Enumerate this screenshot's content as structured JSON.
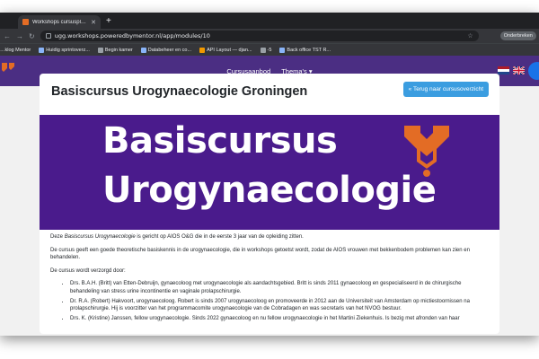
{
  "browser": {
    "tab_title": "Workshops cursusplatform | po",
    "new_tab": "+",
    "url": "ugg.workshops.poweredbymentor.nl/app/modules/10",
    "profile_label": "Onderbreken",
    "bookmarks": [
      "…klog Mentor",
      "Huidig sprintoverz...",
      "Begin kamer",
      "Databeheer en co...",
      "API Layout — djan...",
      "-5",
      "Back office TST R..."
    ]
  },
  "site": {
    "nav": {
      "courses": "Cursusaanbod",
      "themes": "Thema's"
    },
    "colors": {
      "nav_bg": "#4b2e83",
      "banner_bg": "#4a1b8c",
      "accent": "#e36c25",
      "button": "#3b9de0"
    }
  },
  "page": {
    "title": "Basiscursus Urogynaecologie Groningen",
    "back_button": "« Terug naar cursusoverzicht",
    "banner": {
      "line1": "Basiscursus",
      "line2": "Urogynaecologie"
    },
    "intro_pre": "Deze ",
    "intro_em": "Basiscursus Urogynaecologie",
    "intro_post": " is gericht op AIOS O&G die in de eerste 3 jaar van de opleiding zitten.",
    "para2": "De cursus geeft een goede theoretische basiskennis in de urogynaecologie, die in workshops getoetst wordt, zodat de AIOS vrouwen met bekkenbodem problemen kan zien en behandelen.",
    "para3": "De cursus wordt verzorgd door:",
    "speakers": [
      "Drs. B.A.H. (Britt) van Etten-Debruijn, gynaecoloog met urogynaecologie als aandachtsgebied. Britt is sinds 2011 gynaecoloog en gespecialiseerd in de chirurgische behandeling van stress urine incontinentie en vaginale prolapschirurgie.",
      "Dr. R.A. (Robert) Hakvoort, urogynaecoloog. Robert is sinds 2007 urogynaecoloog en promoveerde in 2012 aan de Universiteit van Amsterdam op mictiestoornissen na prolapschirurgie. Hij is voorzitter van het programmacomite urogynaecologie van de Cobradagen en was secretaris van het NVOG bestuur.",
      "Drs. K. (Kristine) Janssen, fellow urogynaecologie. Sinds 2022 gynaecoloog en nu fellow urogynaecologie in het Martini Ziekenhuis. Is bezig met afronden van haar"
    ]
  }
}
